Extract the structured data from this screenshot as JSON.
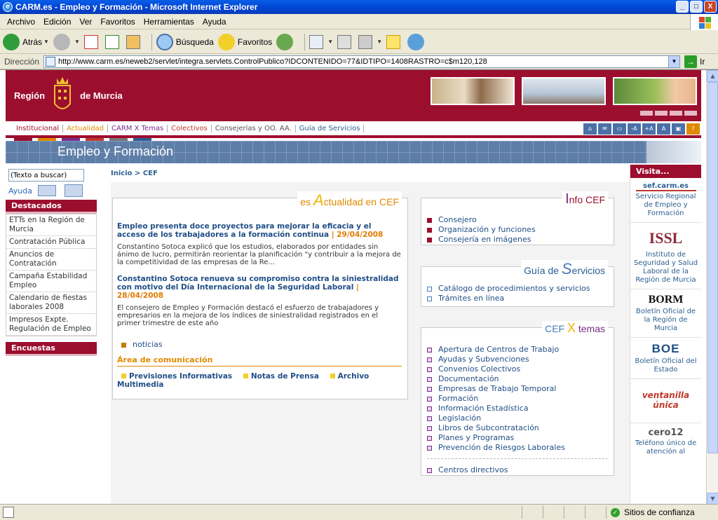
{
  "window": {
    "title": "CARM.es - Empleo y Formación - Microsoft Internet Explorer",
    "ie_logo": "e",
    "buttons": {
      "minimize": "_",
      "maximize": "□",
      "close": "X"
    }
  },
  "menu": [
    "Archivo",
    "Edición",
    "Ver",
    "Favoritos",
    "Herramientas",
    "Ayuda"
  ],
  "toolbar": {
    "back": "Atrás",
    "search": "Búsqueda",
    "favorites": "Favoritos"
  },
  "address": {
    "label": "Dirección",
    "url": "http://www.carm.es/neweb2/servlet/integra.servlets.ControlPublico?IDCONTENIDO=77&IDTIPO=1408RASTRO=c$m120,128",
    "go": "Ir"
  },
  "status": {
    "zone": "Sitios de confianza"
  },
  "site": {
    "logo_left": "Región",
    "logo_right": "de Murcia",
    "nav": [
      "Institucional",
      "Actualidad",
      "CARM X Temas",
      "Colectivos",
      "Consejerías y OO. AA.",
      "Guía de Servicios"
    ],
    "nav_colors": [
      "#9c0e2e",
      "#e08a00",
      "#7a2c8a",
      "#c0392b",
      "#555555",
      "#2b5f91"
    ],
    "tool_labels": [
      "⌂",
      "✉",
      "▭",
      "-A",
      "+A",
      "A",
      "▣",
      "?"
    ],
    "banner_title": "Empleo y Formación",
    "search_placeholder": "(Texto a buscar)",
    "help": "Ayuda",
    "featured_head": "Destacados",
    "featured": [
      "ETTs en la Región de Murcia",
      "Contratación Pública",
      "Anuncios de Contratación",
      "Campaña Estabilidad Empleo",
      "Calendario de fiestas laborales 2008",
      "Impresos Expte. Regulación de Empleo"
    ],
    "polls_head": "Encuestas",
    "breadcrumb": "Inicio > CEF",
    "news_title_pre": "es",
    "news_title_letter": "A",
    "news_title_post": "ctualidad en CEF",
    "news": [
      {
        "title": "Empleo presenta doce proyectos para mejorar la eficacia y el acceso de los trabajadores a la formación continua",
        "date": "| 29/04/2008",
        "body": "Constantino Sotoca explicó que los estudios, elaborados por entidades sin ánimo de lucro, permitirán reorientar la planificación \"y contribuir a la mejora de la competitividad de las empresas de la Re..."
      },
      {
        "title": "Constantino Sotoca renueva su compromiso contra la siniestralidad con motivo del Día Internacional de la Seguridad Laboral",
        "date": "| 28/04/2008",
        "body": "El consejero de Empleo y Formación destacó el esfuerzo de trabajadores y empresarios en la mejora de los índices de siniestralidad registrados en el primer trimestre de este año"
      }
    ],
    "news_link": "noticias",
    "comm_title": "Área de comunicación",
    "comm_links": [
      "Previsiones Informativas",
      "Notas de Prensa",
      "Archivo"
    ],
    "comm_link_cont": "Multimedia",
    "info_letter": "I",
    "info_title": "nfo CEF",
    "info_links": [
      "Consejero",
      "Organización y funciones",
      "Consejería en imágenes"
    ],
    "guide_pre": "Guía de",
    "guide_letter": "S",
    "guide_post": "ervicios",
    "guide_links": [
      "Catálogo de procedimientos y servicios",
      "Trámites en línea"
    ],
    "temas_pre": "CEF",
    "temas_letter": "X",
    "temas_post": "temas",
    "temas_links": [
      "Apertura de Centros de Trabajo",
      "Ayudas y Subvenciones",
      "Convenios Colectivos",
      "Documentación",
      "Empresas de Trabajo Temporal",
      "Formación",
      "Información Estadística",
      "Legislación",
      "Libros de Subcontratación",
      "Planes y Programas",
      "Prevención de Riesgos Laborales"
    ],
    "temas_last": "Centros directivos",
    "visit_head": "Visita...",
    "visits": [
      {
        "logo": "sef.carm.es",
        "caption": "Servicio Regional de Empleo y Formación"
      },
      {
        "logo": "ISSL",
        "caption": "Instituto de Seguridad y Salud Laboral de la Región de Murcia"
      },
      {
        "logo": "BORM",
        "caption": "Boletín Oficial de la Región de Murcia"
      },
      {
        "logo": "BOE",
        "caption": "Boletín Oficial del Estado"
      },
      {
        "logo": "ventanilla única",
        "caption": ""
      },
      {
        "logo": "cero12",
        "caption": "Teléfono único de atención al"
      }
    ]
  }
}
